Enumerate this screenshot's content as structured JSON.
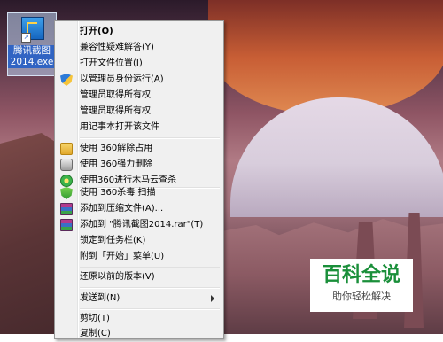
{
  "desktop": {
    "icon_label_line1": "腾讯截图",
    "icon_label_line2": "2014.exe"
  },
  "menu": {
    "open": "打开(O)",
    "compat": "兼容性疑难解答(Y)",
    "open_location": "打开文件位置(I)",
    "run_as_admin": "以管理员身份运行(A)",
    "take_ownership_1": "管理员取得所有权",
    "take_ownership_2": "管理员取得所有权",
    "open_notepad": "用记事本打开该文件",
    "unlock_360": "使用 360解除占用",
    "force_delete_360": "使用 360强力删除",
    "trojan_cloud_360": "使用360进行木马云查杀",
    "scan_360": "使用 360杀毒 扫描",
    "add_to_archive": "添加到压缩文件(A)...",
    "add_to_rar": "添加到 \"腾讯截图2014.rar\"(T)",
    "pin_taskbar": "锁定到任务栏(K)",
    "pin_start": "附到「开始」菜单(U)",
    "restore_previous": "还原以前的版本(V)",
    "send_to": "发送到(N)",
    "cut": "剪切(T)",
    "copy": "复制(C)"
  },
  "watermark": {
    "title": "百科全说",
    "subtitle": "助你轻松解决"
  }
}
